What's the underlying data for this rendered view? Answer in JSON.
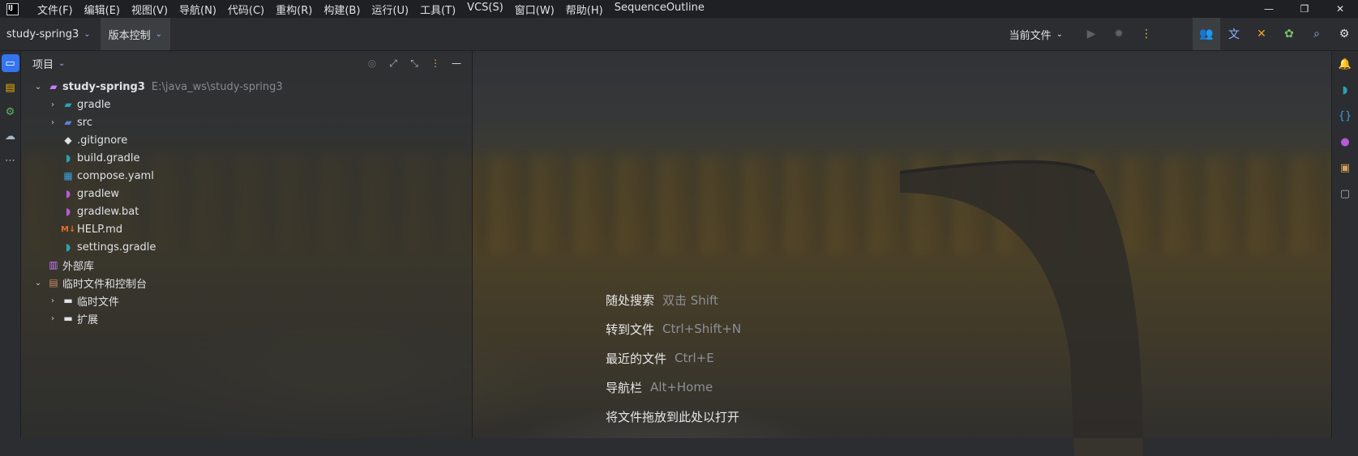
{
  "titlebar": {
    "logo_text": "IJ",
    "menu": [
      "文件(F)",
      "编辑(E)",
      "视图(V)",
      "导航(N)",
      "代码(C)",
      "重构(R)",
      "构建(B)",
      "运行(U)",
      "工具(T)",
      "VCS(S)",
      "窗口(W)",
      "帮助(H)",
      "SequenceOutline"
    ],
    "window_controls": {
      "minimize": "—",
      "restore": "❐",
      "close": "✕"
    }
  },
  "toolbar": {
    "project_name": "study-spring3",
    "vcs_label": "版本控制",
    "run_config": "当前文件",
    "icons": [
      "run-icon",
      "debug-icon",
      "more-vertical-icon",
      "code-with-me-icon",
      "translate-icon",
      "build-tools-icon",
      "ai-assistant-icon",
      "search-icon",
      "settings-icon"
    ]
  },
  "left_strip": {
    "icons": [
      "project-icon",
      "services-icon",
      "run-debug-icon",
      "plugins-icon",
      "more-icon"
    ]
  },
  "project_panel": {
    "title": "项目",
    "tree": [
      {
        "label": "study-spring3",
        "path": "E:\\java_ws\\study-spring3",
        "level": 0,
        "arrow": "⌄",
        "icon": "module-folder-icon"
      },
      {
        "label": "gradle",
        "level": 1,
        "arrow": "›",
        "icon": "gradle-folder-icon"
      },
      {
        "label": "src",
        "level": 1,
        "arrow": "›",
        "icon": "source-folder-icon"
      },
      {
        "label": ".gitignore",
        "level": 1,
        "arrow": "",
        "icon": "git-icon"
      },
      {
        "label": "build.gradle",
        "level": 1,
        "arrow": "",
        "icon": "gradle-file-icon"
      },
      {
        "label": "compose.yaml",
        "level": 1,
        "arrow": "",
        "icon": "docker-icon"
      },
      {
        "label": "gradlew",
        "level": 1,
        "arrow": "",
        "icon": "gradle-script-icon"
      },
      {
        "label": "gradlew.bat",
        "level": 1,
        "arrow": "",
        "icon": "gradle-script-icon"
      },
      {
        "label": "HELP.md",
        "level": 1,
        "arrow": "",
        "icon": "markdown-icon"
      },
      {
        "label": "settings.gradle",
        "level": 1,
        "arrow": "",
        "icon": "gradle-file-icon"
      },
      {
        "label": "外部库",
        "level": 0,
        "arrow": "",
        "icon": "library-icon"
      },
      {
        "label": "临时文件和控制台",
        "level": 0,
        "arrow": "⌄",
        "icon": "scratches-icon"
      },
      {
        "label": "临时文件",
        "level": 1,
        "arrow": "›",
        "icon": "folder-icon"
      },
      {
        "label": "扩展",
        "level": 1,
        "arrow": "›",
        "icon": "folder-icon"
      }
    ]
  },
  "editor": {
    "hints": [
      {
        "label": "随处搜索",
        "key": "双击 Shift"
      },
      {
        "label": "转到文件",
        "key": "Ctrl+Shift+N"
      },
      {
        "label": "最近的文件",
        "key": "Ctrl+E"
      },
      {
        "label": "导航栏",
        "key": "Alt+Home"
      },
      {
        "label": "将文件拖放到此处以打开",
        "key": ""
      }
    ]
  },
  "right_strip": {
    "icons": [
      "notifications-icon",
      "gradle-icon",
      "json-icon",
      "database-icon",
      "maven-icon",
      "coverage-icon"
    ]
  },
  "colors": {
    "accent": "#3574f0",
    "gradle": "#2aa1b3",
    "purple": "#b45bd6",
    "markdown": "#e26f28"
  }
}
